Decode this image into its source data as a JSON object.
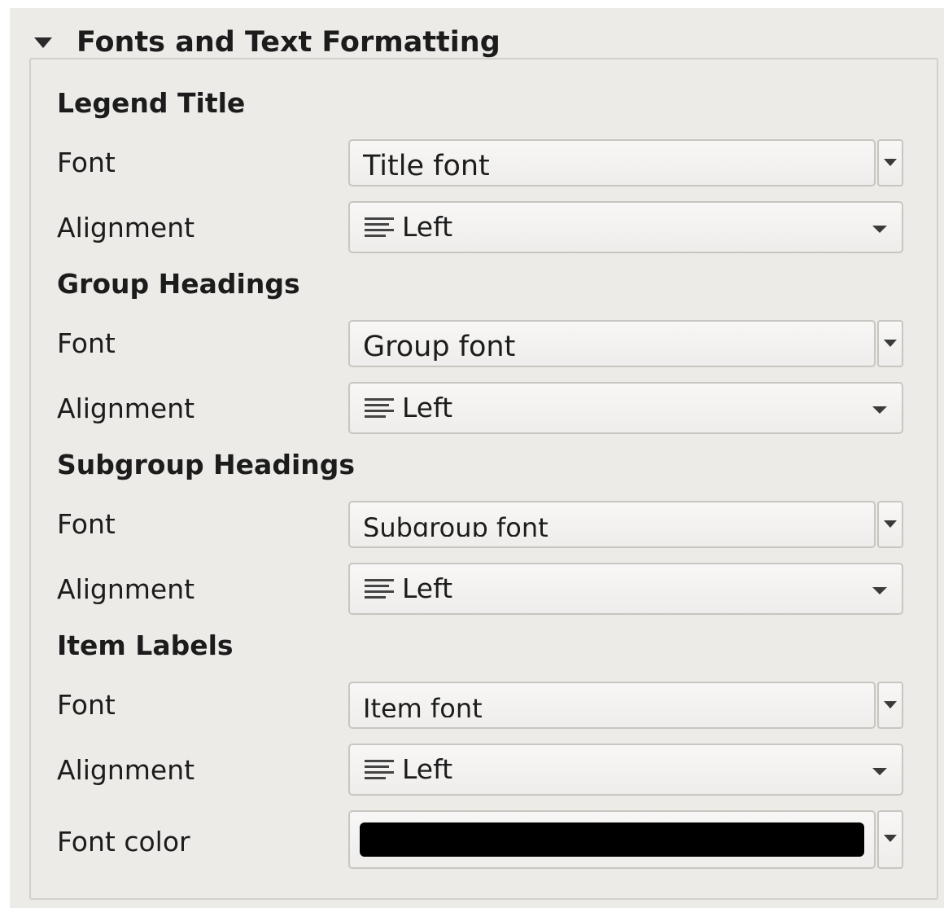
{
  "group": {
    "title": "Fonts and Text Formatting"
  },
  "sections": {
    "legend_title": {
      "heading": "Legend Title",
      "font_label": "Font",
      "font_value": "Title font",
      "alignment_label": "Alignment",
      "alignment_value": "Left"
    },
    "group_headings": {
      "heading": "Group Headings",
      "font_label": "Font",
      "font_value": "Group font",
      "alignment_label": "Alignment",
      "alignment_value": "Left"
    },
    "subgroup_headings": {
      "heading": "Subgroup Headings",
      "font_label": "Font",
      "font_value": "Subgroup font",
      "alignment_label": "Alignment",
      "alignment_value": "Left"
    },
    "item_labels": {
      "heading": "Item Labels",
      "font_label": "Font",
      "font_value": "Item font",
      "alignment_label": "Alignment",
      "alignment_value": "Left",
      "font_color_label": "Font color",
      "font_color_value": "#000000"
    }
  },
  "icons": {
    "collapse": "triangle-down-icon",
    "alignment": "align-left-icon",
    "dropdown": "chevron-down-icon"
  }
}
